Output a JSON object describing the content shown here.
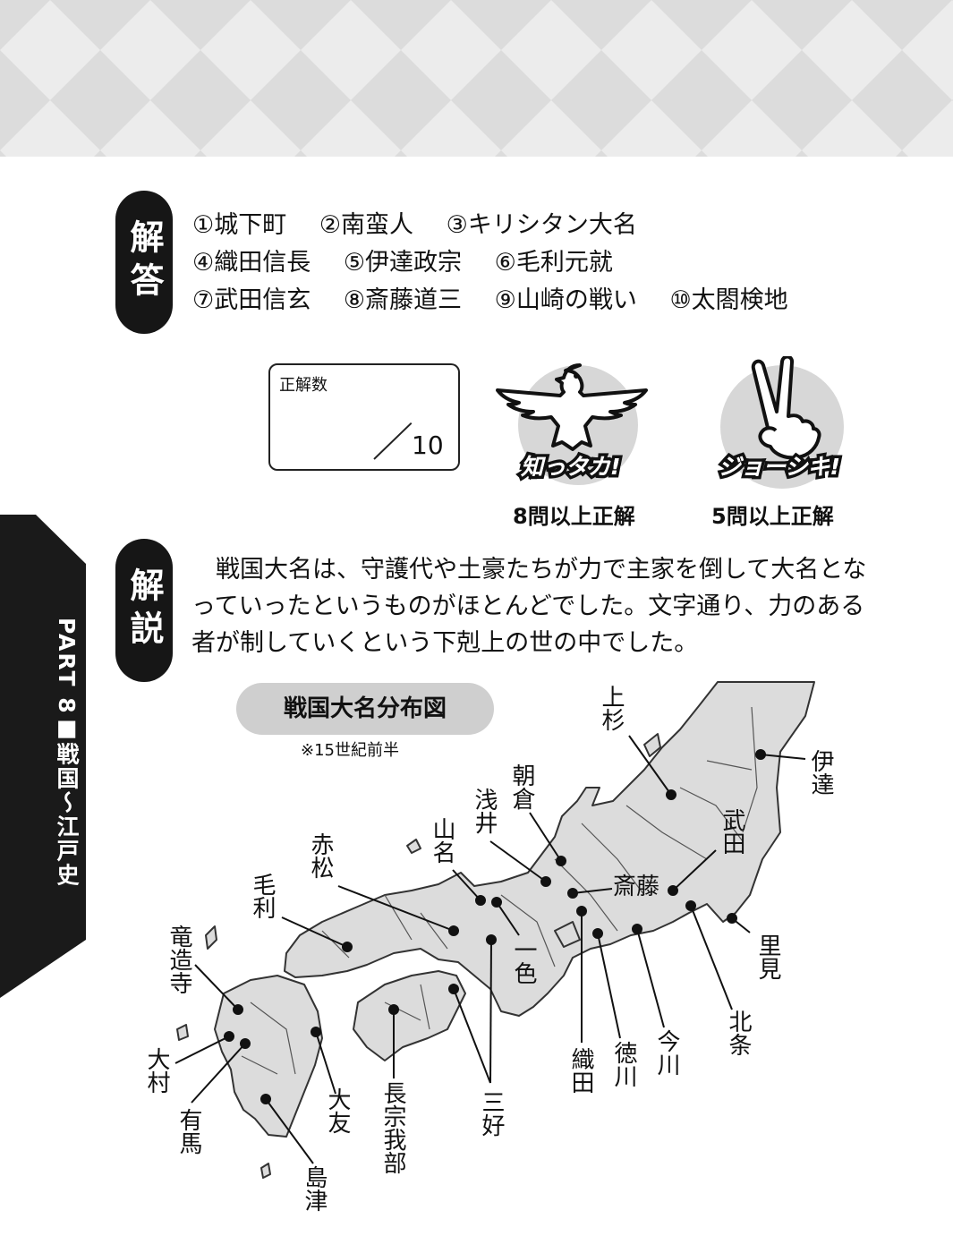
{
  "side_tab": {
    "label": "PART 8■戦国〜江戸史"
  },
  "answer_section": {
    "heading": "解答",
    "rows": [
      [
        "①城下町",
        "②南蛮人",
        "③キリシタン大名"
      ],
      [
        "④織田信長",
        "⑤伊達政宗",
        "⑥毛利元就"
      ],
      [
        "⑦武田信玄",
        "⑧斎藤道三",
        "⑨山崎の戦い",
        "⑩太閤検地"
      ]
    ]
  },
  "score": {
    "label": "正解数",
    "total": "10"
  },
  "badges": [
    {
      "title": "知っタカ!",
      "requirement": "8問以上正解",
      "icon": "eagle-icon"
    },
    {
      "title": "ジョーシキ!",
      "requirement": "5問以上正解",
      "icon": "peace-hand-icon"
    }
  ],
  "explanation_section": {
    "heading": "解説",
    "text": "戦国大名は、守護代や土豪たちが力で主家を倒して大名となっていったというものがほとんどでした。文字通り、力のある者が制していくという下剋上の世の中でした。"
  },
  "map": {
    "title": "戦国大名分布図",
    "note": "※15世紀前半",
    "labels": {
      "uesugi": "上杉",
      "date": "伊達",
      "asakura": "朝倉",
      "azai": "浅井",
      "yamana": "山名",
      "takeda": "武田",
      "akamatsu": "赤松",
      "saito": "斎藤",
      "mori": "毛利",
      "satomi": "里見",
      "ryuzoji": "竜造寺",
      "isshiki": "一色",
      "hojo": "北条",
      "imagawa": "今川",
      "tokugawa": "徳川",
      "oda": "織田",
      "omura": "大村",
      "otomo": "大友",
      "chosokabe": "長宗我部",
      "miyoshi": "三好",
      "arima": "有馬",
      "shimazu": "島津"
    }
  }
}
